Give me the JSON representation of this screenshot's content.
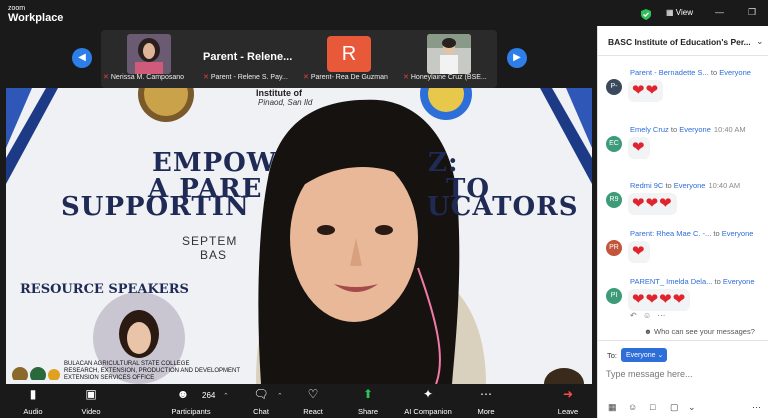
{
  "app": {
    "brand_small": "zoom",
    "brand_large": "Workplace",
    "view_label": "View"
  },
  "gallery": {
    "names": [
      "Nerissa M. Camposano",
      "Parent - Relene S. Pay...",
      "Parent- Rea De Guzman",
      "Honeylaine Cruz (BSE..."
    ],
    "active_speaker": "Parent - Relene...",
    "initial": "R"
  },
  "video": {
    "title_line1": "EMPOW",
    "title_line1b": "Z:",
    "title_line2": "A PARE",
    "title_line2b": "TO",
    "title_line3": "SUPPORTIN",
    "title_line3b": "UCATORS",
    "institute": "Institute of",
    "location": "Pinaod, San Ild",
    "sept": "SEPTEM",
    "bas": "BAS",
    "resource_speakers": "RESOURCE SPEAKERS",
    "org_line1": "BULACAN AGRICULTURAL STATE COLLEGE",
    "org_line2": "RESEARCH, EXTENSION, PRODUCTION AND DEVELOPMENT",
    "org_line3": "EXTENSION SERVICES OFFICE"
  },
  "toolbar": {
    "audio": "Audio",
    "video": "Video",
    "participants": "Participants",
    "participant_count": "264",
    "chat": "Chat",
    "react": "React",
    "share": "Share",
    "ai": "AI Companion",
    "more": "More",
    "leave": "Leave"
  },
  "chat": {
    "title": "BASC Institute of Education's Per...",
    "to_word": "to",
    "messages": [
      {
        "initials": "P-",
        "color": "#3a4a5c",
        "sender": "Parent - Bernadette S...",
        "to": "Everyone",
        "time": "",
        "hearts": 2
      },
      {
        "initials": "EC",
        "color": "#3e9b7a",
        "sender": "Emely Cruz",
        "to": "Everyone",
        "time": "10:40 AM",
        "hearts": 1
      },
      {
        "initials": "R9",
        "color": "#3e9b7a",
        "sender": "Redmi 9C",
        "to": "Everyone",
        "time": "10:40 AM",
        "hearts": 3
      },
      {
        "initials": "PR",
        "color": "#c2553a",
        "sender": "Parent: Rhea Mae C. -...",
        "to": "Everyone",
        "time": "",
        "hearts": 1
      },
      {
        "initials": "PI",
        "color": "#3e9b7a",
        "sender": "PARENT_ Imelda Dela...",
        "to": "Everyone",
        "time": "",
        "hearts": 4
      }
    ],
    "who_can_see": "Who can see your messages?",
    "to_label": "To:",
    "recipient": "Everyone",
    "placeholder": "Type message here..."
  }
}
